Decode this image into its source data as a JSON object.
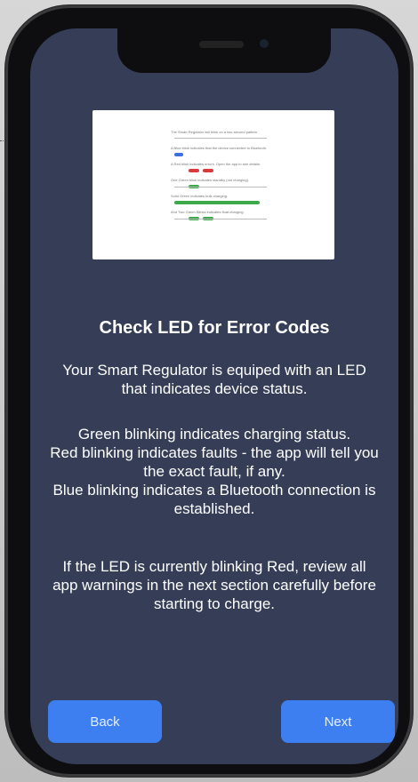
{
  "screen": {
    "title": "Check LED for Error Codes",
    "intro": "Your Smart Regulator is equiped with an LED that indicates device status.",
    "status_info": "Green blinking indicates charging status.\nRed blinking indicates faults - the app will tell you the exact fault, if any.\nBlue blinking indicates a Bluetooth connection is established.",
    "warning": "If the LED is currently blinking Red, review all app warnings in the next section carefully before starting to charge."
  },
  "buttons": {
    "back": "Back",
    "next": "Next"
  },
  "colors": {
    "background": "#363e57",
    "button": "#3d7ff1",
    "led_green": "#3daa4a",
    "led_red": "#d93b3b",
    "led_blue": "#3d6fe0"
  },
  "illustration": {
    "rows": [
      {
        "text": "The Smart Regulator will blink on a two-second pattern.",
        "led": "none"
      },
      {
        "text": "A Blue blink indicates that the device connected to Bluetooth.",
        "led": "blue"
      },
      {
        "text": "A Red blink indicates errors. Open the app to see details.",
        "led": "red"
      },
      {
        "text": "One Green blink indicates standby (not charging).",
        "led": "green"
      },
      {
        "text": "Solid Green indicates bulk charging.",
        "led": "green-solid"
      },
      {
        "text": "And Two Green Blinks indicates float charging.",
        "led": "green-double"
      }
    ]
  }
}
